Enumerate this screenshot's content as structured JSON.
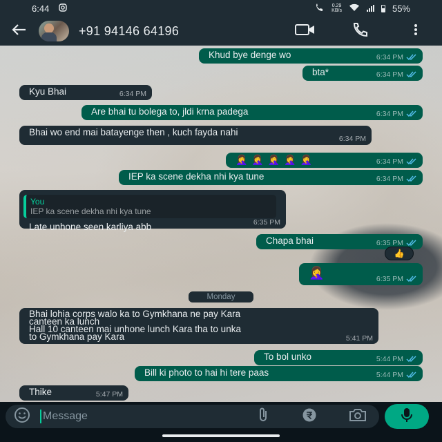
{
  "status_bar": {
    "time": "6:44",
    "speed_value": "0.29",
    "speed_unit": "KB/s",
    "battery": "55%"
  },
  "header": {
    "contact_name": "+91 94146 64196"
  },
  "colors": {
    "outgoing_bubble": "#005c4b",
    "incoming_bubble": "#1f2c34",
    "accent": "#00a884",
    "read_ticks": "#53bdeb"
  },
  "messages": [
    {
      "direction": "out",
      "text": "Khud bye denge wo",
      "time": "6:34 PM"
    },
    {
      "direction": "out",
      "text": "bta*",
      "time": "6:34 PM"
    },
    {
      "direction": "in",
      "text": "Kyu Bhai",
      "time": "6:34 PM"
    },
    {
      "direction": "out",
      "text": "Are bhai tu bolega to, jldi krna padega",
      "time": "6:34 PM"
    },
    {
      "direction": "in",
      "text": "Bhai wo end mai batayenge then , kuch fayda nahi",
      "time": "6:34 PM"
    },
    {
      "direction": "out",
      "text": "🤦‍♀️🤦‍♀️🤦‍♀️🤦‍♀️🤦‍♀️",
      "time": "6:34 PM"
    },
    {
      "direction": "out",
      "text": "IEP ka scene dekha nhi kya tune",
      "time": "6:34 PM"
    },
    {
      "direction": "in",
      "reply_author": "You",
      "reply_text": "IEP ka scene dekha nhi kya tune",
      "text": "Late unhone seen karliya abb",
      "time": "6:35 PM"
    },
    {
      "direction": "out",
      "text": "Chapa bhai",
      "time": "6:35 PM",
      "reaction": "👍"
    },
    {
      "direction": "out",
      "text": "🤦‍♀️",
      "time": "6:35 PM"
    },
    {
      "direction": "in",
      "text_lines": [
        "Bhai lohia corps walo ka to Gymkhana ne pay Kara",
        "canteen ka lunch",
        "Hall 10 canteen mai unhone lunch Kara tha to unka",
        "to Gymkhana pay Kara"
      ],
      "time": "5:41 PM"
    },
    {
      "direction": "out",
      "text": "To bol unko",
      "time": "5:44 PM"
    },
    {
      "direction": "out",
      "text": "Bill ki photo to hai hi tere paas",
      "time": "5:44 PM"
    },
    {
      "direction": "in",
      "text": "Thike",
      "time": "5:47 PM"
    }
  ],
  "date_chip": "Monday",
  "input": {
    "placeholder": "Message"
  },
  "icons": {
    "back": "arrow-left-icon",
    "video": "video-call-icon",
    "call": "phone-icon",
    "menu": "more-vert-icon",
    "emoji": "emoji-icon",
    "attach": "paperclip-icon",
    "payment": "rupee-icon",
    "camera": "camera-icon",
    "mic": "mic-icon"
  }
}
